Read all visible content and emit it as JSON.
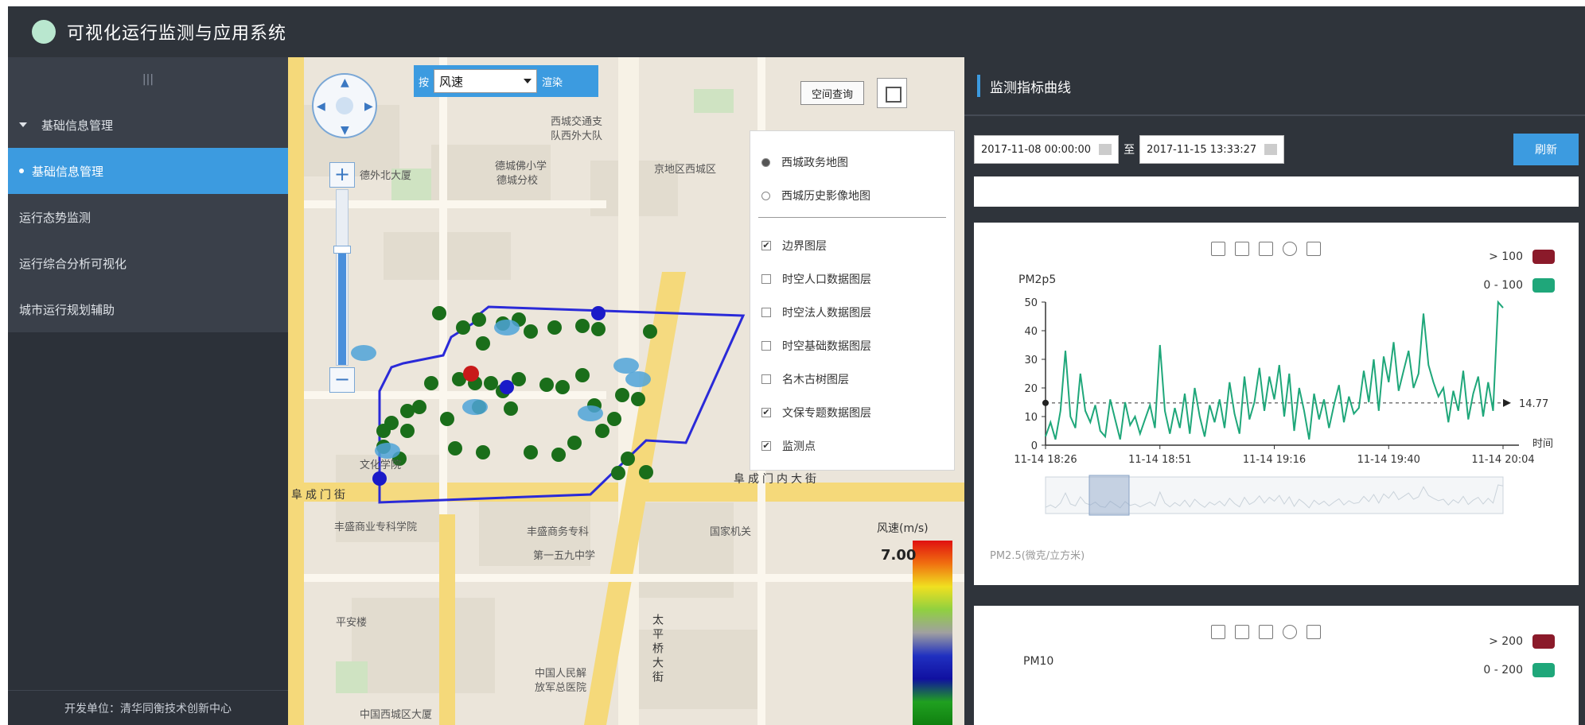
{
  "app": {
    "title": "可视化运行监测与应用系统"
  },
  "sidebar": {
    "toggle": "|||",
    "items": [
      {
        "label": "基础信息管理",
        "state": "expanded"
      },
      {
        "label": "基础信息管理",
        "state": "active"
      },
      {
        "label": "运行态势监测",
        "state": "collapsed"
      },
      {
        "label": "运行综合分析可视化",
        "state": "collapsed"
      },
      {
        "label": "城市运行规划辅助",
        "state": "collapsed"
      }
    ],
    "footer": "开发单位：清华同衡技术创新中心"
  },
  "map": {
    "layer_select": {
      "prefix": "按",
      "value": "风速",
      "suffix": "渲染"
    },
    "space_query_label": "空间查询",
    "layer_panel": {
      "radios": [
        {
          "label": "西城政务地图",
          "selected": true
        },
        {
          "label": "西城历史影像地图",
          "selected": false
        }
      ],
      "checks": [
        {
          "label": "边界图层",
          "checked": true
        },
        {
          "label": "时空人口数据图层",
          "checked": false
        },
        {
          "label": "时空法人数据图层",
          "checked": false
        },
        {
          "label": "时空基础数据图层",
          "checked": false
        },
        {
          "label": "名木古树图层",
          "checked": false
        },
        {
          "label": "文保专题数据图层",
          "checked": true
        },
        {
          "label": "监测点",
          "checked": true
        }
      ]
    },
    "legend": {
      "title": "风速(m/s)",
      "max": "7.00"
    },
    "labels": {
      "l1": "西城交通支",
      "l2": "队西外大队",
      "l3": "德城佛小学",
      "l4": "德城分校",
      "l5": "德外北大厦",
      "l6": "京地区西城区",
      "l7": "丰盛商务专科",
      "l8": "第一五九中学",
      "l9": "中国人民解",
      "l10": "放军总医院",
      "l11": "中国西城区大厦",
      "l12": "丰盛商业专科学院",
      "l13": "国家机关",
      "l14": "平安楼",
      "l15": "文化学院",
      "road1": "阜成门内大街",
      "road2": "阜成门街",
      "road3": "太平桥大街"
    }
  },
  "right_panel": {
    "title": "监测指标曲线",
    "start_date": "2017-11-08 00:00:00",
    "separator": "至",
    "end_date": "2017-11-15 13:33:27",
    "refresh_label": "刷新",
    "chart1": {
      "ylabel": "PM2p5",
      "unit_note": "PM2.5(微克/立方米)",
      "legend": [
        {
          "label": "> 100",
          "color": "#8b1a2a"
        },
        {
          "label": "0 - 100",
          "color": "#1fa77a"
        }
      ]
    },
    "chart2": {
      "ylabel": "PM10",
      "legend": [
        {
          "label": "> 200",
          "color": "#8b1a2a"
        },
        {
          "label": "0 - 200",
          "color": "#1fa77a"
        }
      ]
    }
  },
  "chart_data": {
    "type": "line",
    "ylabel": "PM2p5",
    "xlabel": "时间",
    "ylim": [
      0,
      50
    ],
    "yticks": [
      0,
      10,
      20,
      30,
      40,
      50
    ],
    "x_ticks": [
      "11-14 18:26",
      "11-14 18:51",
      "11-14 19:16",
      "11-14 19:40",
      "11-14 20:04"
    ],
    "mean_line": {
      "value": 14.77,
      "label": "14.77"
    },
    "series": [
      {
        "color": "#1fa77a",
        "values": [
          3,
          8,
          2,
          12,
          33,
          10,
          6,
          25,
          12,
          8,
          14,
          5,
          3,
          16,
          9,
          2,
          15,
          7,
          10,
          4,
          9,
          14,
          6,
          35,
          12,
          4,
          13,
          6,
          18,
          4,
          20,
          10,
          3,
          14,
          8,
          16,
          6,
          22,
          11,
          4,
          24,
          9,
          15,
          27,
          12,
          24,
          16,
          28,
          10,
          25,
          5,
          20,
          12,
          2,
          18,
          9,
          16,
          6,
          14,
          21,
          8,
          17,
          11,
          13,
          26,
          15,
          30,
          12,
          31,
          22,
          36,
          19,
          26,
          33,
          20,
          25,
          46,
          28,
          22,
          17,
          20,
          8,
          19,
          12,
          26,
          9,
          18,
          24,
          10,
          22,
          12,
          50,
          48
        ]
      }
    ]
  }
}
